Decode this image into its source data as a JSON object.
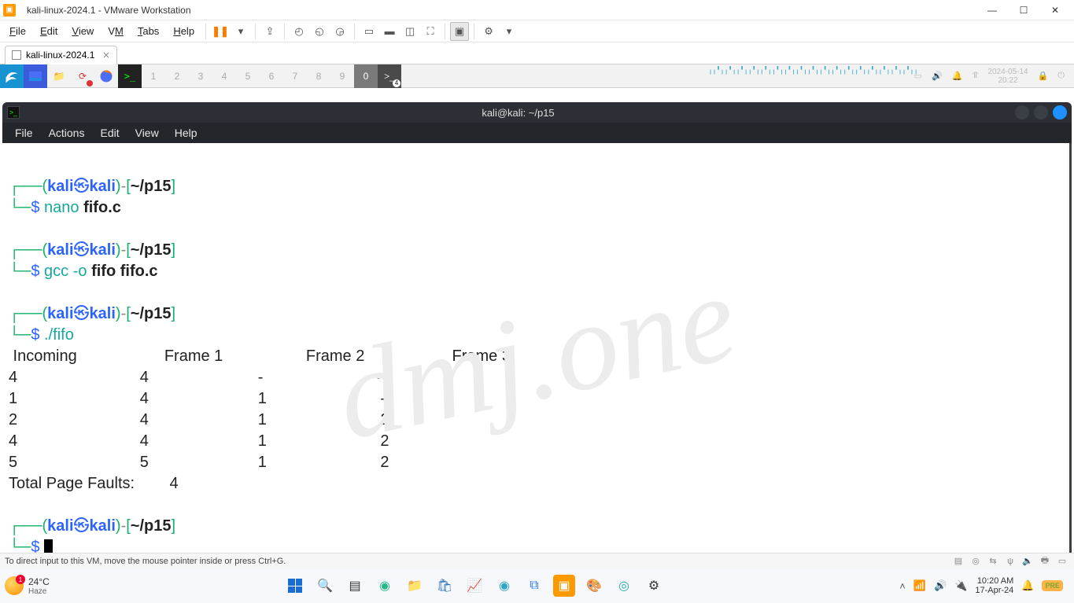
{
  "titlebar": {
    "title": "kali-linux-2024.1 - VMware Workstation"
  },
  "menubar": {
    "items": [
      "File",
      "Edit",
      "View",
      "VM",
      "Tabs",
      "Help"
    ]
  },
  "vm_tab": {
    "label": "kali-linux-2024.1"
  },
  "kali_panel": {
    "workspaces": [
      "1",
      "2",
      "3",
      "4",
      "5",
      "6",
      "7",
      "8",
      "9",
      "0"
    ],
    "active_ws": "0",
    "task_badge": "4",
    "clock_date": "2024-05-14",
    "clock_time": "20:22"
  },
  "terminal": {
    "title": "kali@kali: ~/p15",
    "menus": [
      "File",
      "Actions",
      "Edit",
      "View",
      "Help"
    ],
    "user": "kali",
    "host": "kali",
    "path": "~/p15",
    "commands": {
      "c1": "nano",
      "c1_arg": "fifo.c",
      "c2a": "gcc",
      "c2b": "-o",
      "c2_arg": "fifo fifo.c",
      "c3": "./fifo"
    },
    "output": {
      "headers": [
        "Incoming",
        "Frame 1",
        "Frame 2",
        "Frame 3"
      ],
      "rows": [
        [
          "4",
          "4",
          "-",
          "-"
        ],
        [
          "1",
          "4",
          "1",
          "-"
        ],
        [
          "2",
          "4",
          "1",
          "2"
        ],
        [
          "4",
          "4",
          "1",
          "2"
        ],
        [
          "5",
          "5",
          "1",
          "2"
        ]
      ],
      "footer_label": "Total Page Faults:",
      "footer_value": "4"
    }
  },
  "watermark": "dmj.one",
  "statusbar": {
    "hint": "To direct input to this VM, move the mouse pointer inside or press Ctrl+G."
  },
  "windows_taskbar": {
    "temp": "24°C",
    "weather": "Haze",
    "time": "10:20 AM",
    "date": "17-Apr-24"
  }
}
